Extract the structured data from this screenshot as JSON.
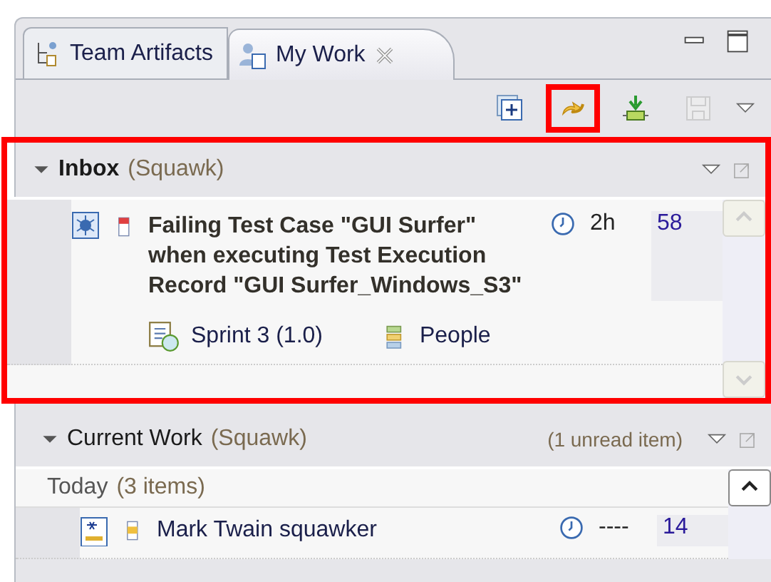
{
  "tabs": [
    {
      "label": "Team Artifacts",
      "kind": "artifacts",
      "selected": false,
      "closable": false
    },
    {
      "label": "My Work",
      "kind": "mywork",
      "selected": true,
      "closable": true
    }
  ],
  "toolbar": [
    {
      "kind": "add",
      "highlighted": false,
      "disabled": false
    },
    {
      "kind": "sync",
      "highlighted": true,
      "disabled": false
    },
    {
      "kind": "download",
      "highlighted": false,
      "disabled": false
    },
    {
      "kind": "save",
      "highlighted": false,
      "disabled": true
    }
  ],
  "inbox": {
    "title": "Inbox",
    "scope": "(Squawk)",
    "highlighted": true,
    "item": {
      "title": "Failing Test Case \"GUI Surfer\" when executing Test Execution Record \"GUI Surfer_Windows_S3\"",
      "time": "2h",
      "id": "58",
      "plan": "Sprint 3 (1.0)",
      "category": "People"
    }
  },
  "current_work": {
    "title": "Current Work",
    "scope": "(Squawk)",
    "unread": "(1 unread item)",
    "group": {
      "label": "Today",
      "count": "(3 items)"
    },
    "item": {
      "title": "Mark Twain squawker",
      "time": "----",
      "id": "14"
    }
  }
}
